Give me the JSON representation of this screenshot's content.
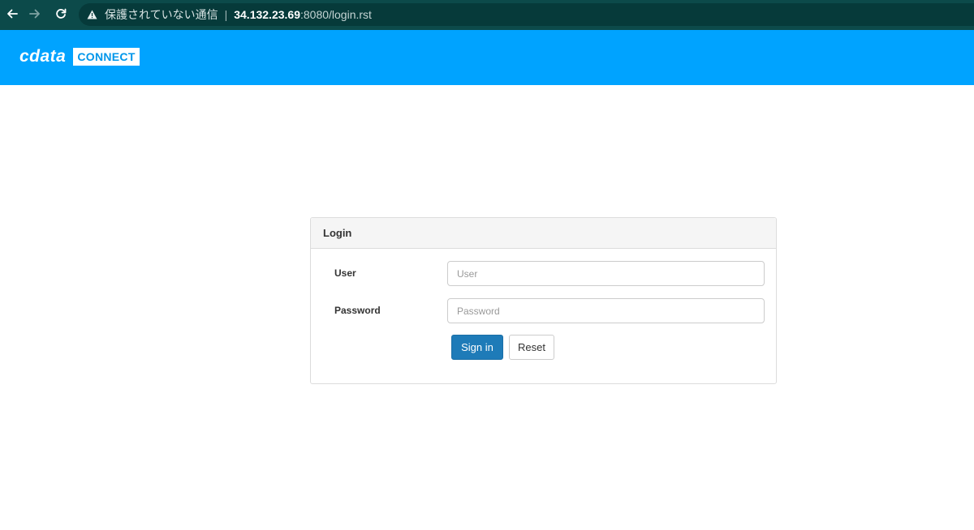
{
  "browser": {
    "security_text": "保護されていない通信",
    "separator": "|",
    "url_host": "34.132.23.69",
    "url_rest": ":8080/login.rst",
    "icons": {
      "back": "arrow-left-icon",
      "forward": "arrow-right-icon",
      "reload": "reload-icon",
      "warning": "warning-triangle-icon"
    }
  },
  "header": {
    "logo_word": "cdata",
    "logo_badge": "CONNECT",
    "color": "#00a3ff"
  },
  "login": {
    "title": "Login",
    "user_label": "User",
    "user_placeholder": "User",
    "user_value": "",
    "password_label": "Password",
    "password_placeholder": "Password",
    "password_value": "",
    "signin_label": "Sign in",
    "reset_label": "Reset",
    "signin_color": "#1e7bb8"
  }
}
